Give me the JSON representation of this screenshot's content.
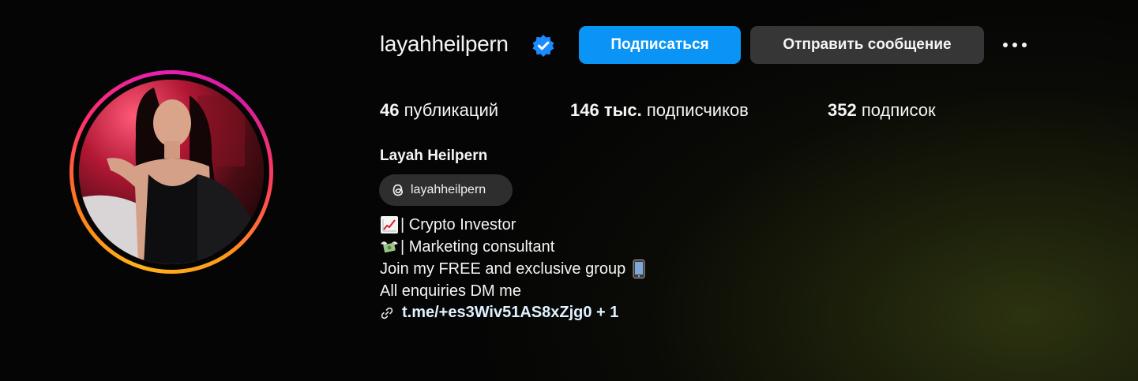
{
  "profile": {
    "username": "layahheilpern",
    "full_name": "Layah Heilpern",
    "verified_icon": "verified-badge-icon",
    "accent_color": "#0a95f6"
  },
  "actions": {
    "follow_label": "Подписаться",
    "message_label": "Отправить сообщение",
    "more_icon": "more-options-icon"
  },
  "stats": {
    "posts_count": "46",
    "posts_label": "публикаций",
    "followers_count": "146 тыс.",
    "followers_label": "подписчиков",
    "following_count": "352",
    "following_label": "подписок"
  },
  "threads": {
    "handle": "layahheilpern",
    "icon": "threads-icon"
  },
  "bio": {
    "line1": "| Crypto Investor",
    "line1_icon": "chart-increasing-icon",
    "line2": "| Marketing consultant",
    "line2_icon": "money-with-wings-icon",
    "line3": "Join my FREE and exclusive group",
    "line3_icon": "mobile-phone-icon",
    "line4": "All enquiries DM me"
  },
  "link": {
    "text": "t.me/+es3Wiv51AS8xZjg0 + 1",
    "icon": "link-icon"
  }
}
